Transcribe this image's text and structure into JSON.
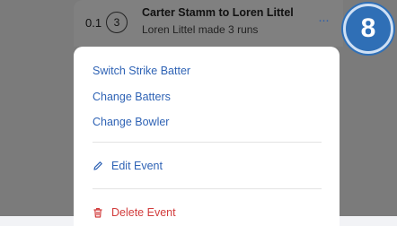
{
  "event": {
    "over": "0.1",
    "ball": "3",
    "title": "Carter Stamm to Loren Littel",
    "subtitle": "Loren Littel made 3 runs",
    "more": "···"
  },
  "badge": {
    "number": "8"
  },
  "menu": {
    "items": [
      {
        "label": "Switch Strike Batter"
      },
      {
        "label": "Change Batters"
      },
      {
        "label": "Change Bowler"
      },
      {
        "label": "Edit Event",
        "icon": "pencil-icon"
      },
      {
        "label": "Delete Event",
        "icon": "trash-icon"
      }
    ]
  },
  "colors": {
    "accent": "#2f63b5",
    "danger": "#d23c3c",
    "badge": "#2f6fb6"
  }
}
